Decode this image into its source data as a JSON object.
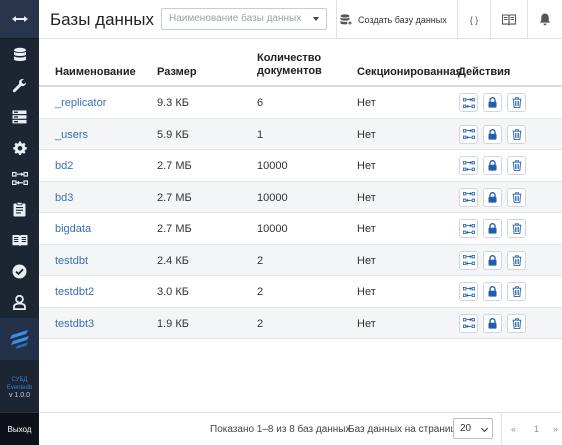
{
  "header": {
    "title": "Базы данных",
    "search_placeholder": "Наименование базы данных",
    "create_label": "Создать базу данных",
    "json_label": "{ }"
  },
  "sidebar": {
    "items": [
      "databases-icon",
      "wrench-icon",
      "servers-icon",
      "gear-icon",
      "replication-icon",
      "clipboard-icon",
      "book-icon",
      "check-circle-icon",
      "user-icon"
    ],
    "version_name": "СУБД",
    "version_sub": "Eventedb",
    "version": "v 1.0.0",
    "exit_label": "Выход"
  },
  "table": {
    "columns": {
      "name": "Наименование",
      "size": "Размер",
      "count": "Количество документов",
      "sharded": "Секционированная",
      "actions": "Действия"
    },
    "rows": [
      {
        "name": "_replicator",
        "size": "9.3 КБ",
        "count": "6",
        "sharded": "Нет"
      },
      {
        "name": "_users",
        "size": "5.9 КБ",
        "count": "1",
        "sharded": "Нет"
      },
      {
        "name": "bd2",
        "size": "2.7 МБ",
        "count": "10000",
        "sharded": "Нет"
      },
      {
        "name": "bd3",
        "size": "2.7 МБ",
        "count": "10000",
        "sharded": "Нет"
      },
      {
        "name": "bigdata",
        "size": "2.7 МБ",
        "count": "10000",
        "sharded": "Нет"
      },
      {
        "name": "testdbt",
        "size": "2.4 КБ",
        "count": "2",
        "sharded": "Нет"
      },
      {
        "name": "testdbt2",
        "size": "3.0 КБ",
        "count": "2",
        "sharded": "Нет"
      },
      {
        "name": "testdbt3",
        "size": "1.9 КБ",
        "count": "2",
        "sharded": "Нет"
      }
    ]
  },
  "footer": {
    "shown": "Показано 1–8 из 8 баз данных",
    "per_page_label": "Баз данных на странице",
    "per_page_value": "20",
    "first": "«",
    "page": "1",
    "last": "»"
  },
  "colors": {
    "sidebar_bg": "#1c2532",
    "link": "#3a6fb0",
    "accent": "#1f5fb0"
  }
}
